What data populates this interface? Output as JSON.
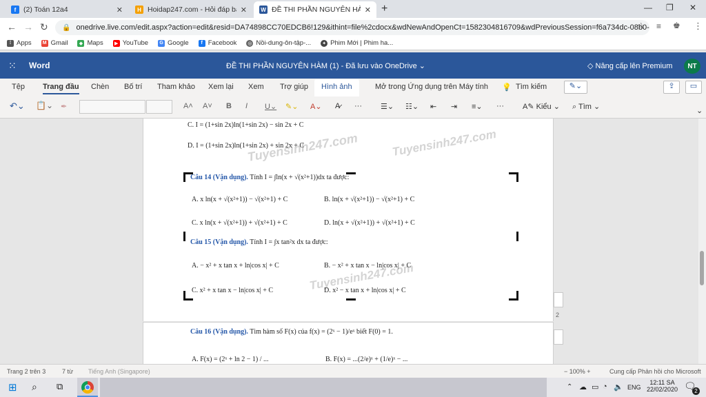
{
  "browser": {
    "tabs": [
      {
        "title": "(2) Toán 12a4",
        "icon": "facebook-icon",
        "color": "#1877f2"
      },
      {
        "title": "Hoidap247.com - Hỏi đáp bài tập",
        "icon": "hoidap-icon",
        "color": "#f4a000"
      },
      {
        "title": "ĐỀ THI PHẦN NGUYÊN HÀM (1).d",
        "icon": "word-icon",
        "color": "#2b579a"
      }
    ],
    "url": "onedrive.live.com/edit.aspx?action=edit&resid=DA74898CC70EDCB6!129&ithint=file%2cdocx&wdNewAndOpenCt=1582304816709&wdPreviousSession=f6a734dc-08b0-4...",
    "bookmarks": [
      {
        "label": "Apps",
        "icon": "apps-grid-icon"
      },
      {
        "label": "Gmail",
        "icon": "gmail-icon"
      },
      {
        "label": "Maps",
        "icon": "maps-icon"
      },
      {
        "label": "YouTube",
        "icon": "youtube-icon"
      },
      {
        "label": "Google",
        "icon": "google-icon"
      },
      {
        "label": "Facebook",
        "icon": "facebook-icon"
      },
      {
        "label": "Nồi-dung-ôn-tập-...",
        "icon": "globe-icon"
      },
      {
        "label": "Phim Mới | Phim ha...",
        "icon": "film-icon"
      }
    ]
  },
  "word": {
    "app_name": "Word",
    "doc_title": "ĐỀ THI PHẦN NGUYÊN HÀM (1)  -  Đã lưu vào OneDrive ⌄",
    "premium": "Nâng cấp lên Premium",
    "avatar": "NT",
    "accent": "#2b579a",
    "ribbon_tabs": [
      "Tệp",
      "Trang đầu",
      "Chèn",
      "Bố trí",
      "Tham khảo",
      "Xem lại",
      "Xem",
      "Trợ giúp",
      "Hình ảnh",
      "Mở trong Ứng dụng trên Máy tính",
      "Tìm kiếm"
    ],
    "ribbon": {
      "styles": "Kiểu",
      "find": "Tìm"
    }
  },
  "doc": {
    "c13": "C. I = (1+sin 2x)ln(1+sin 2x) − sin 2x + C",
    "d13": "D. I = (1+sin 2x)ln(1+sin 2x) + sin 2x + C",
    "q14_head": "Câu 14 (Vận dụng).",
    "q14_body": " Tính  I = ∫ln(x + √(x²+1))dx  ta được:",
    "q14_a": "A.  x ln(x + √(x²+1)) − √(x²+1) + C",
    "q14_b": "B.  ln(x + √(x²+1)) − √(x²+1) + C",
    "q14_c": "C.  x ln(x + √(x²+1)) + √(x²+1) + C",
    "q14_d": "D.  ln(x + √(x²+1)) + √(x²+1) + C",
    "q15_head": "Câu 15 (Vận dụng).",
    "q15_body": " Tính  I = ∫x tan²x dx  ta được:",
    "q15_a": "A. − x² + x tan x + ln|cos x| + C",
    "q15_b": "B. − x² + x tan x − ln|cos x| + C",
    "q15_c": "C.   x² + x tan x − ln|cos x| + C",
    "q15_d": "D.   x² − x tan x + ln|cos x| + C",
    "page_num": "2",
    "q16_head": "Câu 16 (Vận dụng).",
    "q16_body": " Tìm hàm số F(x) của  f(x) = (2ˣ − 1)/eˣ  biết F(0) = 1.",
    "q16_a": "A.  F(x) = (2ˣ + ln 2 − 1) / ...",
    "q16_b": "B.  F(x) = ...(2/e)ˣ + (1/e)ˣ − ...",
    "watermark": "Tuyensinh247.com"
  },
  "status": {
    "page": "Trang 2 trên 3",
    "words": "7 từ",
    "lang": "Tiếng Anh (Singapore)",
    "zoom": "100%",
    "feedback": "Cung cấp Phản hồi cho Microsoft"
  },
  "taskbar": {
    "lang": "ENG",
    "time": "12:11 SA",
    "date": "22/02/2020",
    "notif": "2"
  }
}
